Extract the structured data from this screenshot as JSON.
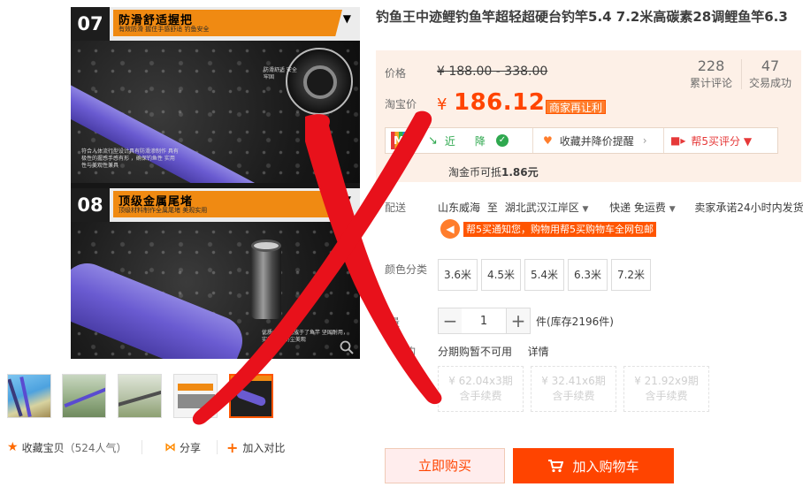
{
  "gallery": {
    "panel1": {
      "num": "07",
      "title": "防滑舒适握把",
      "sub": "有效防滑 握住手感舒适 钓鱼安全",
      "note_right": "防滑舒适 安全牢固",
      "note_left": "符合人体流行型设计具有防滑渗制作 具有极性的握感手感有形 ，确保钓鱼性 实用性与美观性兼具"
    },
    "panel2": {
      "num": "08",
      "title": "顶级金属尾堵",
      "sub": "顶级材料制作全属尾堵 美观实用",
      "note": "优质金属尾堵放于了鱼竿 坚固耐用，实用工具 防尘美观"
    },
    "thumb_count": 5,
    "active_thumb": 4
  },
  "actions": {
    "favorite": "收藏宝贝",
    "favorite_count": "（524人气）",
    "share": "分享",
    "compare": "加入对比"
  },
  "title": "钓鱼王中迹鲤钓鱼竿超轻超硬台钓竿5.4 7.2米高碳素28调鲤鱼竿6.3",
  "price": {
    "label": "价格",
    "original": "¥ 188.00 - 338.00",
    "reviews_num": "228",
    "reviews_label": "累计评论",
    "sales_num": "47",
    "sales_label": "交易成功",
    "taobao_label": "淘宝价",
    "yen": "¥",
    "current": "186.12",
    "promo": "商家再让利",
    "bar": {
      "recent": "近",
      "drop": "降",
      "collect": "收藏并降价提醒",
      "rate": "帮5买评分 ▼"
    },
    "coin": "淘金币可抵",
    "coin_value": "1.86元"
  },
  "shipping": {
    "label": "配送",
    "from": "山东威海",
    "to_word": "至",
    "to": "湖北武汉江岸区",
    "method": "快递 免运费",
    "promise": "卖家承诺24小时内发货",
    "announce": "帮5买通知您，购物用帮5买购物车全网包邮"
  },
  "sku": {
    "label": "颜色分类",
    "options": [
      "3.6米",
      "4.5米",
      "5.4米",
      "6.3米",
      "7.2米"
    ]
  },
  "quantity": {
    "label": "量",
    "value": "1",
    "minus": "−",
    "plus": "+",
    "stock": "件(库存2196件)"
  },
  "installment": {
    "label": "购",
    "status": "分期购暂不可用",
    "detail": "详情",
    "plans": [
      {
        "price": "¥ 62.04x3期",
        "fee": "含手续费"
      },
      {
        "price": "¥ 32.41x6期",
        "fee": "含手续费"
      },
      {
        "price": "¥ 21.92x9期",
        "fee": "含手续费"
      }
    ]
  },
  "buttons": {
    "buy": "立即购买",
    "cart": "加入购物车"
  },
  "colors": {
    "accent": "#ff4400",
    "price_bg": "#fdf0e7",
    "overlay_x": "#e8111b",
    "rod": "#6a5bd1"
  }
}
